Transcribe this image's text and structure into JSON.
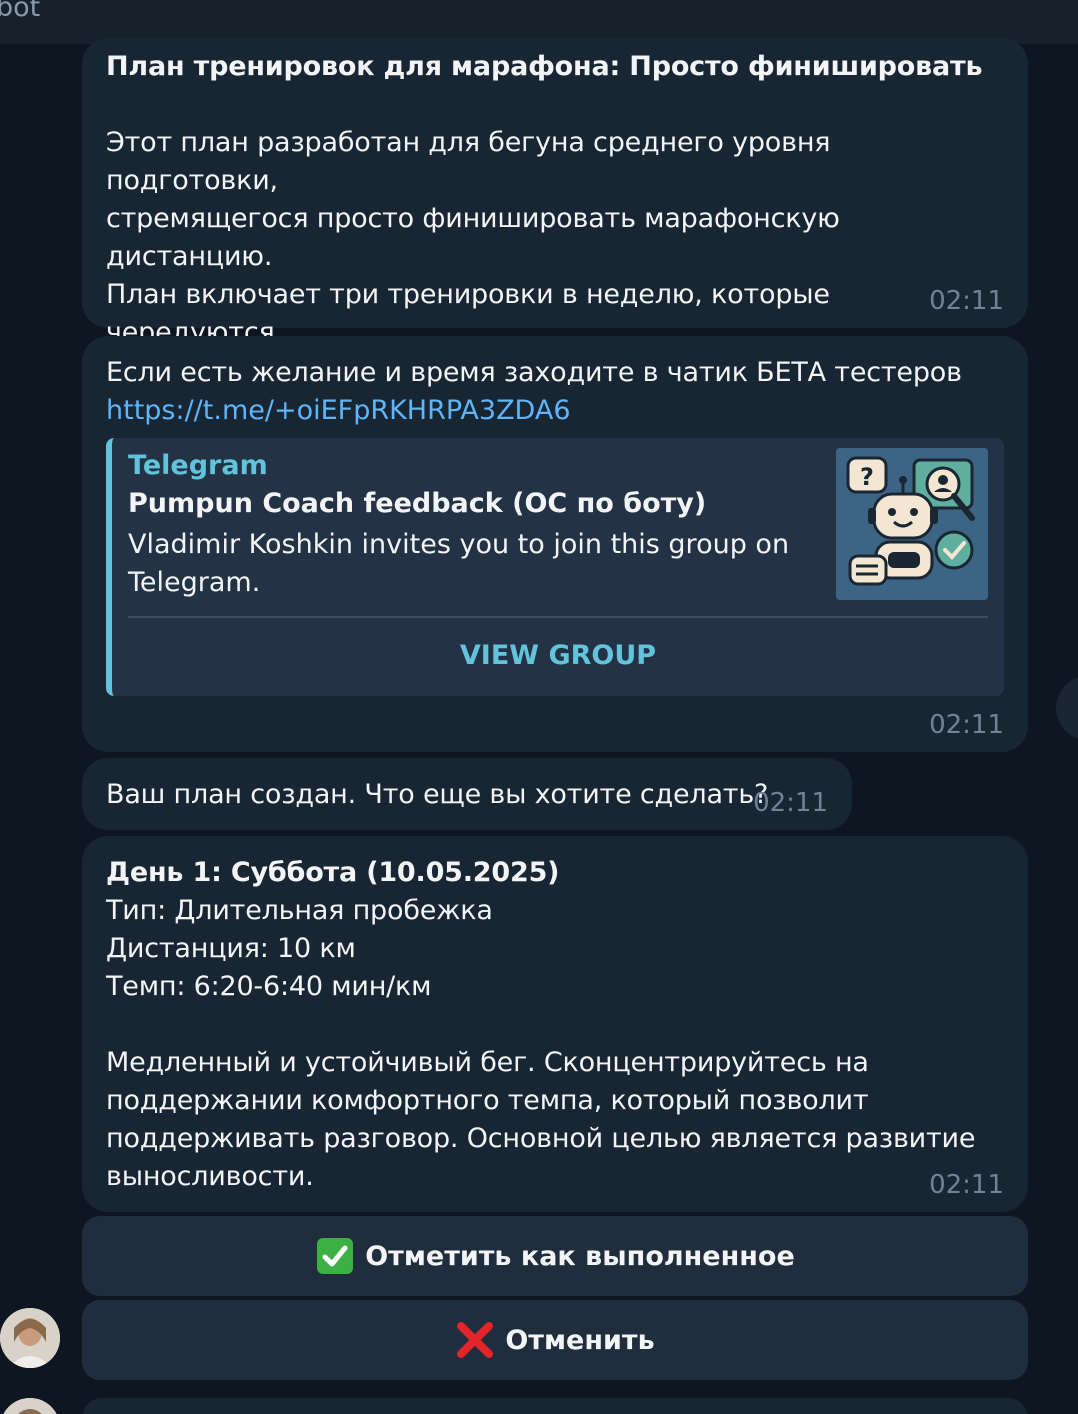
{
  "header": {
    "title": "bot"
  },
  "messages": {
    "plan_intro": {
      "title": "План тренировок для марафона: Просто финишировать",
      "body": "Этот план разработан для бегуна среднего уровня подготовки,\nстремящегося просто финишировать марафонскую дистанцию.\nПлан включает три тренировки в неделю, которые чередуются\nмежду длительными пробежками, интервальными\nтренировками и восстановительными забегами.",
      "time": "02:11"
    },
    "beta_invite": {
      "text": "Если есть желание и время заходите в чатик БЕТА тестеров",
      "link": "https://t.me/+oiEFpRKHRPA3ZDA6",
      "preview": {
        "site": "Telegram",
        "title": "Pumpun Coach feedback (ОС по боту)",
        "description": "Vladimir Koshkin invites you to join this group on\nTelegram.",
        "button": "VIEW GROUP",
        "thumb_icon": "robot-support-icon"
      },
      "time": "02:11"
    },
    "plan_created": {
      "text": "Ваш план создан. Что еще вы хотите сделать?",
      "time": "02:11"
    },
    "day1": {
      "title": "День 1: Суббота (10.05.2025)",
      "details": "Тип: Длительная пробежка\nДистанция: 10 км\nТемп: 6:20-6:40 мин/км",
      "body": "Медленный и устойчивый бег. Сконцентрируйтесь на\nподдержании комфортного темпа, который позволит\nподдерживать разговор. Основной целью является развитие\nвыносливости.",
      "time": "02:11"
    }
  },
  "keyboard": {
    "done_label": "Отметить как выполненное",
    "done_icon": "check-mark-icon",
    "cancel_label": "Отменить",
    "cancel_icon": "cross-mark-icon"
  },
  "colors": {
    "background": "#0e1621",
    "bubble": "#182533",
    "accent": "#62c3da",
    "link": "#5eb5f7"
  }
}
